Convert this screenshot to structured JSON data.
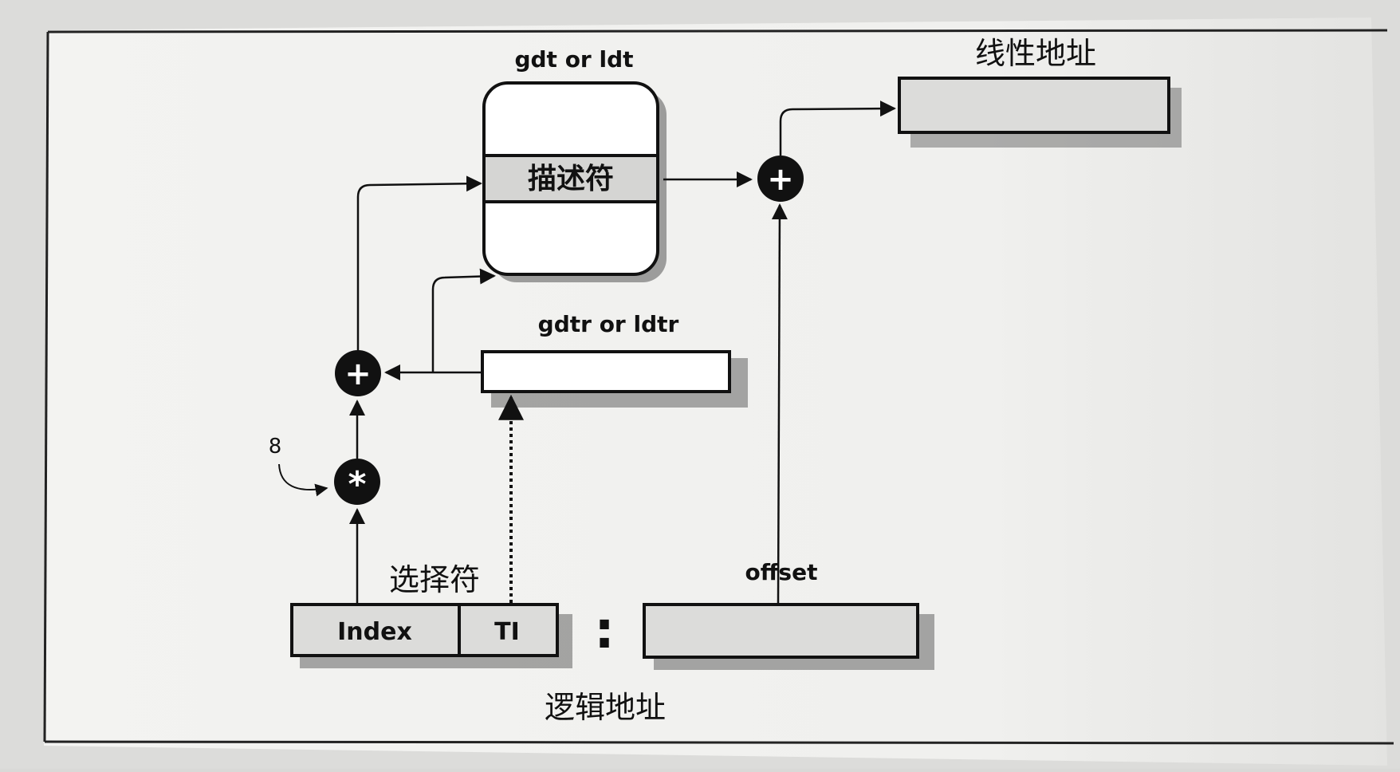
{
  "diagram": {
    "table_label": "gdt or ldt",
    "descriptor_label": "描述符",
    "register_label": "gdtr or ldtr",
    "multiplier_label": "8",
    "selector_label": "选择符",
    "index_label": "Index",
    "ti_label": "TI",
    "separator": ":",
    "offset_label": "offset",
    "logical_address_label": "逻辑地址",
    "linear_address_label": "线性地址",
    "add_symbol": "+",
    "multiply_symbol": "*"
  }
}
